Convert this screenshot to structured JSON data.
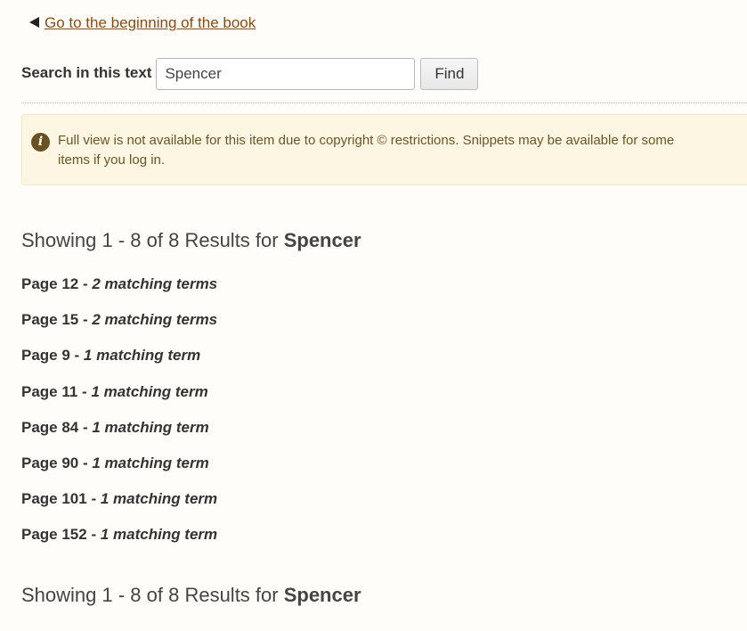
{
  "back_link": {
    "label": "Go to the beginning of the book"
  },
  "search": {
    "label": "Search in this text",
    "value": "Spencer",
    "button_label": "Find"
  },
  "notice": {
    "icon": "info-icon",
    "text": "Full view is not available for this item due to copyright © restrictions. Snippets may be available for some items if you log in."
  },
  "results": {
    "summary_prefix": "Showing 1 - 8 of 8 Results for ",
    "query": "Spencer",
    "items": [
      {
        "page": "Page 12",
        "terms": "2 matching terms"
      },
      {
        "page": "Page 15",
        "terms": "2 matching terms"
      },
      {
        "page": "Page 9",
        "terms": "1 matching term"
      },
      {
        "page": "Page 11",
        "terms": "1 matching term"
      },
      {
        "page": "Page 84",
        "terms": "1 matching term"
      },
      {
        "page": "Page 90",
        "terms": "1 matching term"
      },
      {
        "page": "Page 101",
        "terms": "1 matching term"
      },
      {
        "page": "Page 152",
        "terms": "1 matching term"
      }
    ]
  },
  "colors": {
    "link": "#8a4b12",
    "notice_background": "#fcf6e3",
    "notice_text": "#6b5525",
    "info_icon": "#6b5122"
  }
}
